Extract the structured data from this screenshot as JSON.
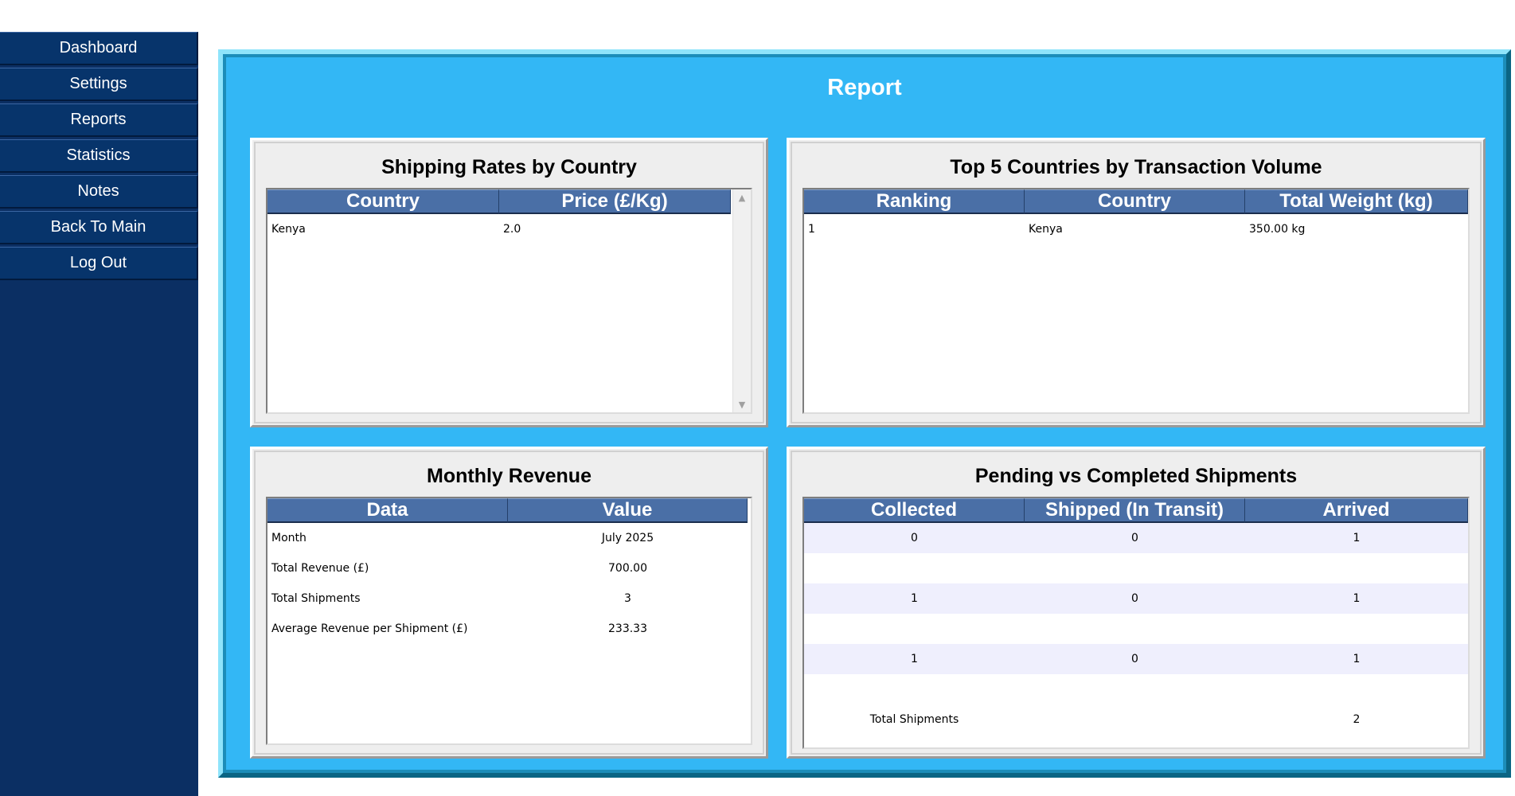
{
  "sidebar": {
    "items": [
      {
        "label": "Dashboard"
      },
      {
        "label": "Settings"
      },
      {
        "label": "Reports"
      },
      {
        "label": "Statistics"
      },
      {
        "label": "Notes"
      },
      {
        "label": "Back To Main"
      },
      {
        "label": "Log Out"
      }
    ]
  },
  "report": {
    "title": "Report"
  },
  "shipping_rates": {
    "title": "Shipping Rates by Country",
    "columns": [
      "Country",
      "Price (£/Kg)"
    ],
    "rows": [
      [
        "Kenya",
        "2.0"
      ]
    ]
  },
  "top_countries": {
    "title": "Top 5 Countries by Transaction Volume",
    "columns": [
      "Ranking",
      "Country",
      "Total Weight (kg)"
    ],
    "rows": [
      [
        "1",
        "Kenya",
        "350.00 kg"
      ]
    ]
  },
  "monthly_revenue": {
    "title": "Monthly Revenue",
    "columns": [
      "Data",
      "Value"
    ],
    "rows": [
      [
        "Month",
        "July 2025"
      ],
      [
        "Total Revenue (£)",
        "700.00"
      ],
      [
        "Total Shipments",
        "3"
      ],
      [
        "Average Revenue per Shipment (£)",
        "233.33"
      ]
    ]
  },
  "shipments": {
    "title": "Pending vs Completed Shipments",
    "columns": [
      "Collected",
      "Shipped (In Transit)",
      "Arrived"
    ],
    "rows": [
      [
        "0",
        "0",
        "1"
      ],
      [
        "",
        "",
        ""
      ],
      [
        "1",
        "0",
        "1"
      ],
      [
        "",
        "",
        ""
      ],
      [
        "1",
        "0",
        "1"
      ],
      [
        "",
        "",
        ""
      ],
      [
        "Total Shipments",
        "",
        "2"
      ]
    ]
  },
  "colors": {
    "sidebar_bg": "#0b2f63",
    "frame_bg": "#33b7f5",
    "header_bg": "#4a6fa6",
    "alt_row": "#efeffd"
  }
}
